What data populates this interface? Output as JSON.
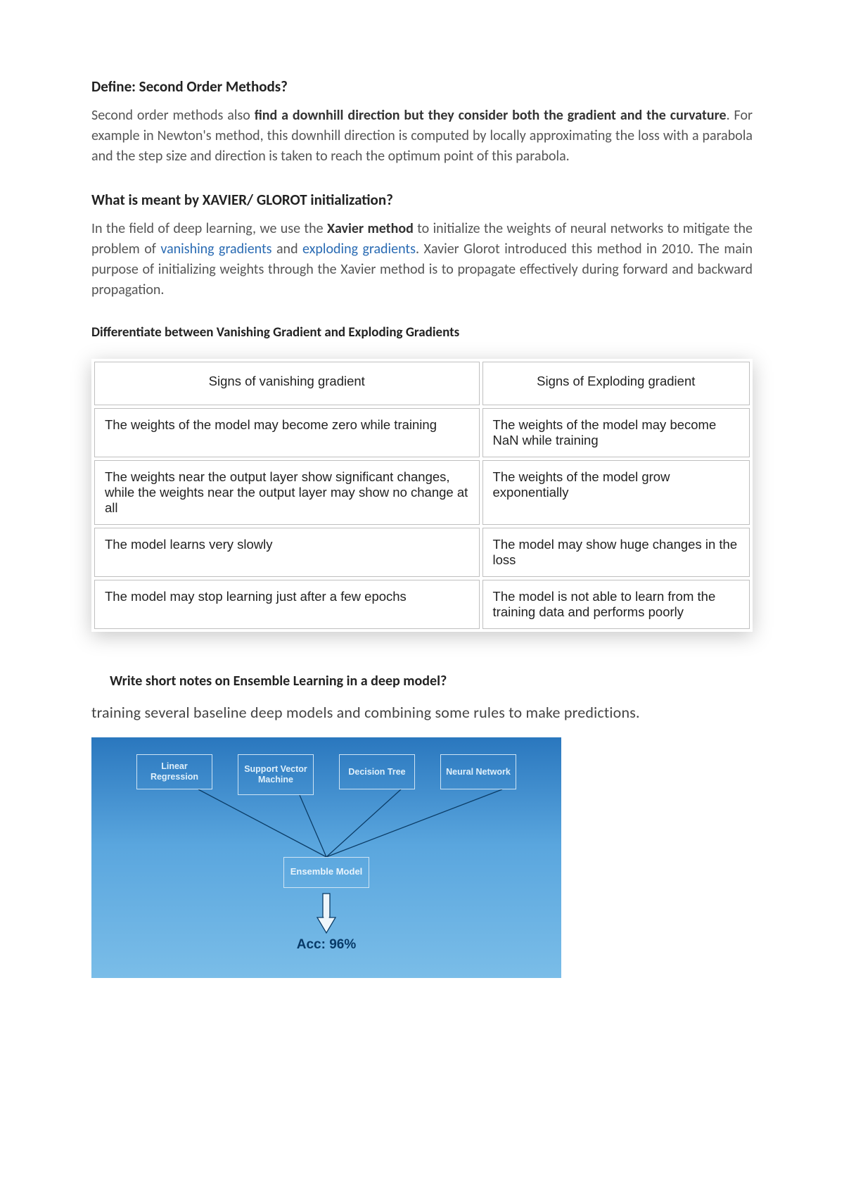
{
  "q1": {
    "heading": "Define: Second Order Methods?",
    "p_lead": "Second order methods also ",
    "p_bold": "find a downhill direction but they consider both the gradient and the curvature",
    "p_tail": ". For example in Newton's method, this downhill direction is computed by locally approximating the loss with a parabola and the step size and direction is taken to reach the optimum point of this parabola."
  },
  "q2": {
    "heading": "What is meant by XAVIER/ GLOROT initialization?",
    "p_a": "In the field of deep learning, we use the ",
    "p_bold": "Xavier method",
    "p_b": " to initialize the weights of neural networks to mitigate the problem of ",
    "link1": "vanishing gradients",
    "p_and": " and ",
    "link2": "exploding gradients",
    "p_c": ". Xavier Glorot introduced this method in 2010. The main purpose of initializing weights through the Xavier method is to propagate effectively during forward and backward propagation."
  },
  "table": {
    "title": "Differentiate between Vanishing Gradient and Exploding Gradients",
    "headers": [
      "Signs of vanishing gradient",
      "Signs of Exploding gradient"
    ],
    "rows": [
      [
        "The weights of the model may become zero while training",
        "The weights of the model may become NaN while training"
      ],
      [
        "The weights near the output layer show significant changes, while the weights near the output layer may show no change at all",
        "The weights of the model grow exponentially"
      ],
      [
        "The model learns very slowly",
        "The model may show huge changes in the loss"
      ],
      [
        "The model may stop learning just after a few epochs",
        "The model is not able to learn from the training data and performs poorly"
      ]
    ]
  },
  "q4": {
    "heading": "Write short notes on Ensemble Learning in a deep model?",
    "para": "training several baseline deep models and combining some rules to make predictions."
  },
  "diagram": {
    "node1": "Linear Regression",
    "node2": "Support Vector Machine",
    "node3": "Decision Tree",
    "node4": "Neural Network",
    "ensemble": "Ensemble Model",
    "accuracy": "Acc: 96%"
  }
}
